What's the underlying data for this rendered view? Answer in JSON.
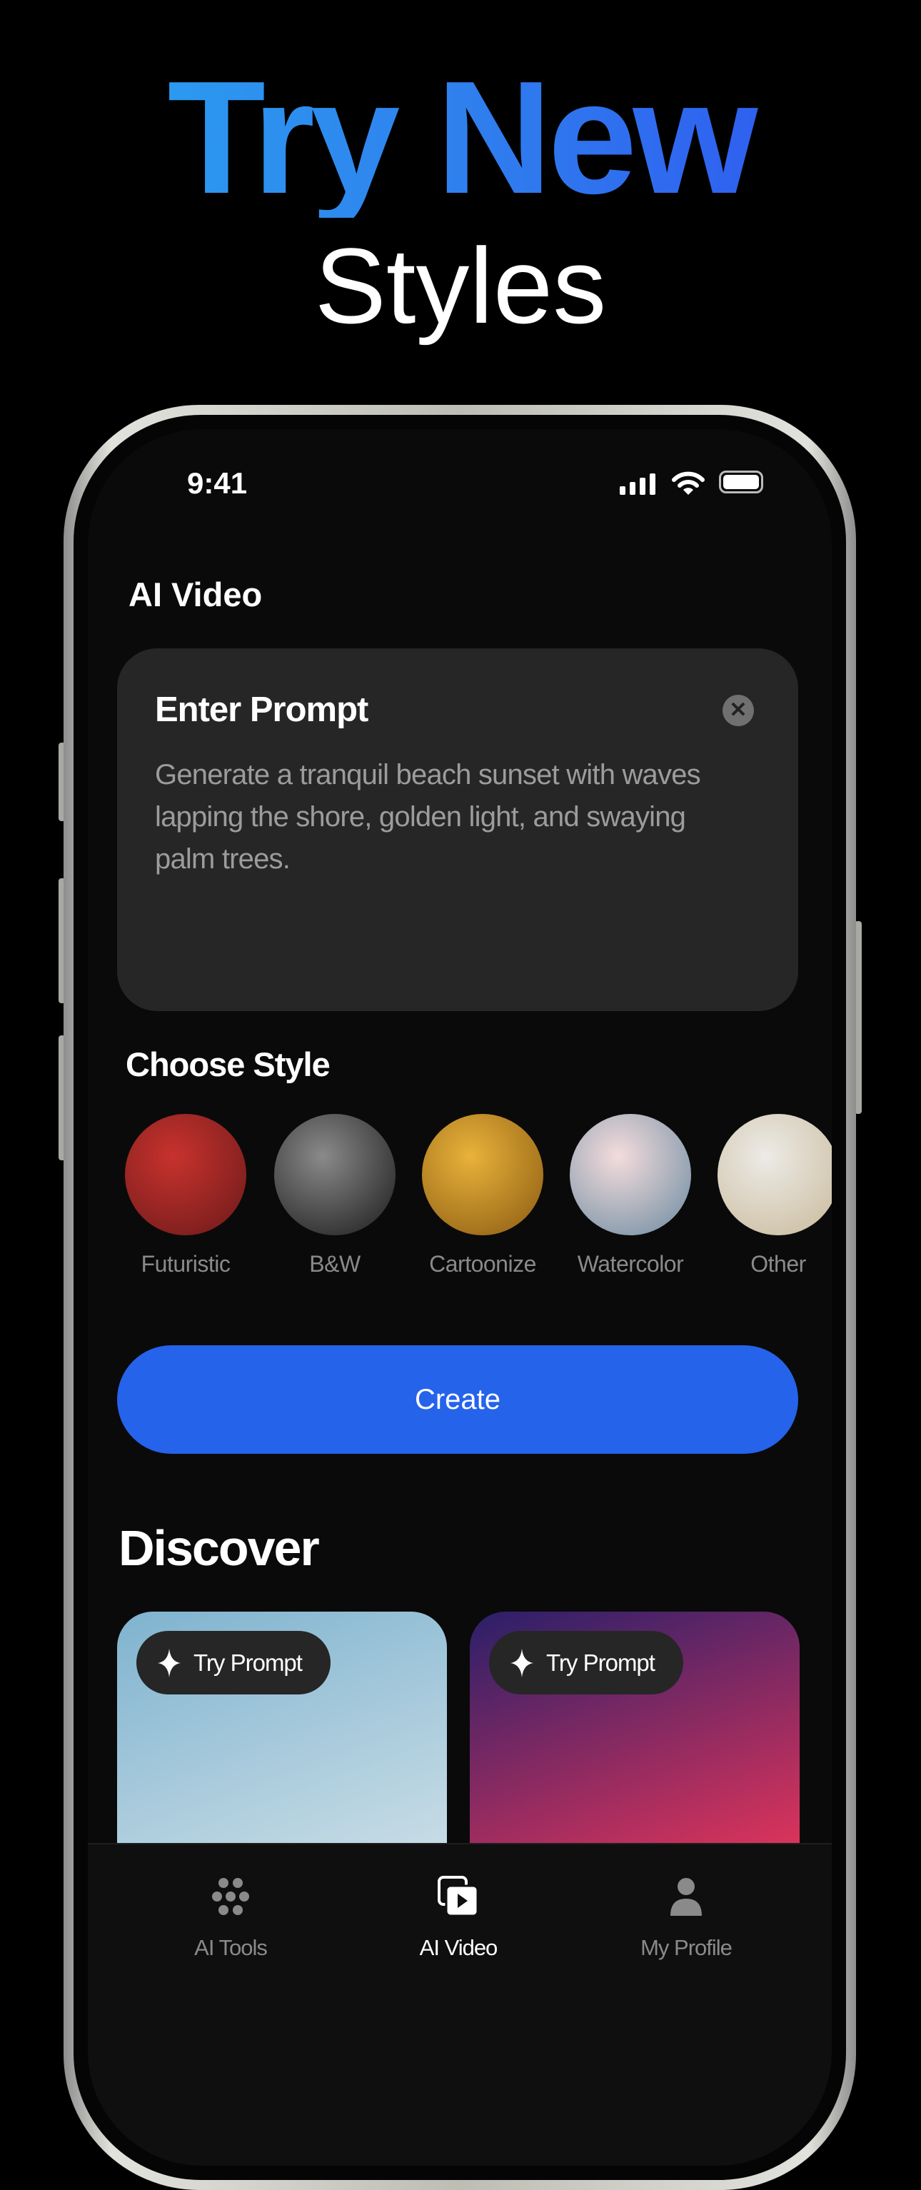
{
  "headline": {
    "line1": "Try New",
    "line2": "Styles"
  },
  "status_bar": {
    "time": "9:41"
  },
  "header": {
    "title": "AI Video"
  },
  "prompt_card": {
    "title": "Enter Prompt",
    "text": "Generate a tranquil beach sunset with waves lapping the shore, golden light, and swaying palm trees."
  },
  "styles": {
    "title": "Choose Style",
    "items": [
      {
        "label": "Futuristic",
        "colors": [
          "#c8322d",
          "#6a1a1a"
        ]
      },
      {
        "label": "B&W",
        "colors": [
          "#8a8a8a",
          "#1a1a1a"
        ]
      },
      {
        "label": "Cartoonize",
        "colors": [
          "#e9b23a",
          "#8a5a12"
        ]
      },
      {
        "label": "Watercolor",
        "colors": [
          "#f4dcdc",
          "#6a8aa0"
        ]
      },
      {
        "label": "Other",
        "colors": [
          "#ecebe6",
          "#c9b89a"
        ]
      }
    ]
  },
  "create_button": {
    "label": "Create",
    "color": "#2563eb"
  },
  "discover": {
    "title": "Discover",
    "cards": [
      {
        "button": "Try Prompt",
        "colors": [
          "#7fb3cf",
          "#c9dde6"
        ]
      },
      {
        "button": "Try Prompt",
        "colors": [
          "#2a1f6a",
          "#e0345a"
        ]
      }
    ]
  },
  "tab_bar": {
    "items": [
      {
        "label": "AI Tools",
        "icon": "grid-dots-icon",
        "active": false
      },
      {
        "label": "AI Video",
        "icon": "video-play-icon",
        "active": true
      },
      {
        "label": "My Profile",
        "icon": "person-icon",
        "active": false
      }
    ]
  }
}
